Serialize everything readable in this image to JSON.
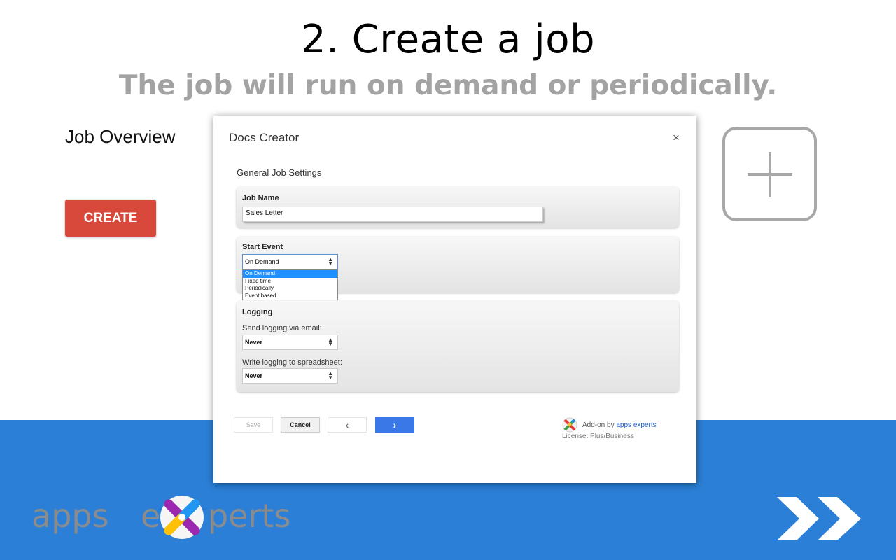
{
  "slide": {
    "title": "2. Create a job",
    "subtitle": "The job will run on demand or periodically."
  },
  "left_panel": {
    "job_overview": "Job Overview",
    "create_button": "CREATE"
  },
  "dialog": {
    "title": "Docs Creator",
    "close": "×",
    "section_heading": "General Job Settings",
    "job_name": {
      "label": "Job Name",
      "value": "Sales Letter"
    },
    "start_event": {
      "label": "Start Event",
      "selected": "On Demand",
      "options": [
        "On Demand",
        "Fixed time",
        "Periodically",
        "Event based"
      ]
    },
    "logging": {
      "label": "Logging",
      "email_label": "Send logging via email:",
      "email_value": "Never",
      "sheet_label": "Write logging to spreadsheet:",
      "sheet_value": "Never"
    },
    "buttons": {
      "save": "Save",
      "cancel": "Cancel",
      "prev": "‹",
      "next": "›"
    },
    "addon": {
      "prefix": "Add-on by ",
      "link": "apps experts",
      "license": "License: Plus/Business"
    }
  },
  "branding": {
    "part1": "apps",
    "part2": "e",
    "part3": "perts"
  },
  "colors": {
    "band": "#2b7fd6",
    "create_button": "#d9493b",
    "next_button": "#3b78e7",
    "selected_option": "#1e90ff"
  },
  "icons": {
    "plus": "plus-icon",
    "close": "close-icon",
    "next_slide": "double-chevron-right-icon",
    "brand_x": "colorful-x-logo"
  }
}
